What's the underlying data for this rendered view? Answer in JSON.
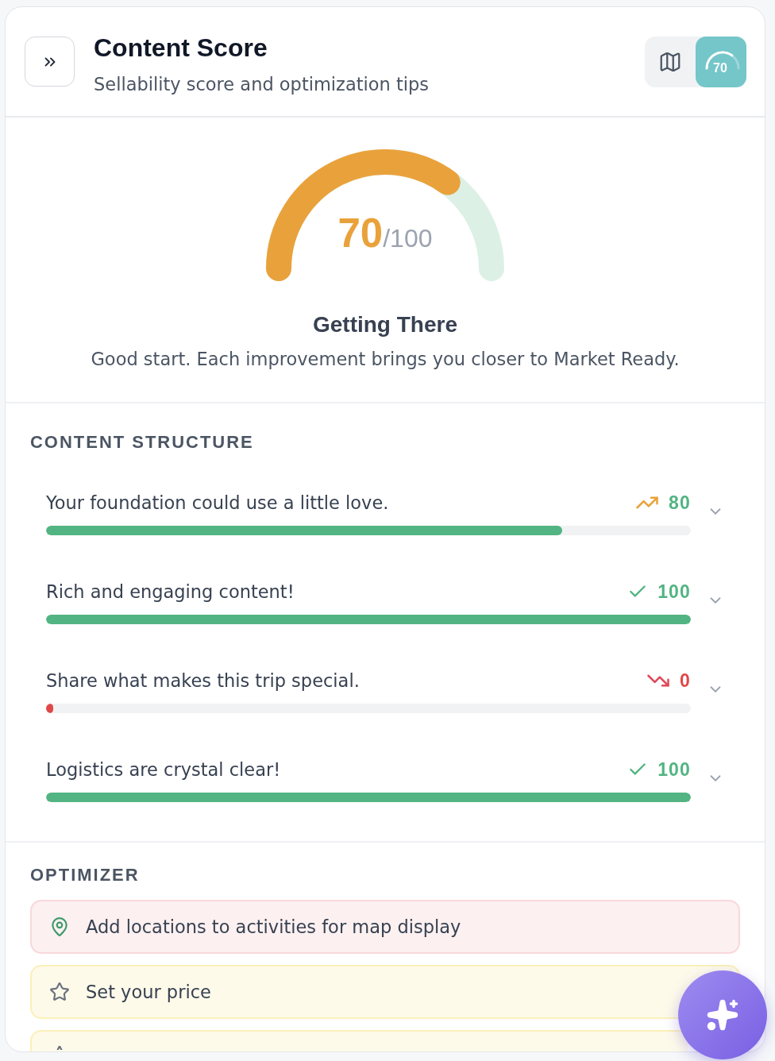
{
  "header": {
    "title": "Content Score",
    "subtitle": "Sellability score and optimization tips",
    "view_toggle": [
      {
        "kind": "map",
        "selected": false
      },
      {
        "kind": "score",
        "selected": true,
        "label": "70"
      }
    ]
  },
  "score": {
    "value": "70",
    "max": "/100",
    "status": "Getting There",
    "message": "Good start. Each improvement brings you closer to Market Ready."
  },
  "content_structure": {
    "heading": "CONTENT STRUCTURE",
    "items": [
      {
        "kind": "improving",
        "label": "Your foundation could use a little love.",
        "score": "80",
        "level": 0.8,
        "expanded": false
      },
      {
        "kind": "complete",
        "label": "Rich and engaging content!",
        "score": "100",
        "level": 1,
        "expanded": false
      },
      {
        "kind": "declining",
        "label": "Share what makes this trip special.",
        "score": "0",
        "level": 0,
        "expanded": false
      },
      {
        "kind": "complete",
        "label": "Logistics are crystal clear!",
        "score": "100",
        "level": 1,
        "expanded": false
      }
    ]
  },
  "optimizer": {
    "heading": "OPTIMIZER",
    "items": [
      {
        "kind": "location",
        "text": "Add locations to activities for map display"
      },
      {
        "kind": "star",
        "text": "Set your price"
      },
      {
        "kind": "star"
      }
    ]
  }
}
